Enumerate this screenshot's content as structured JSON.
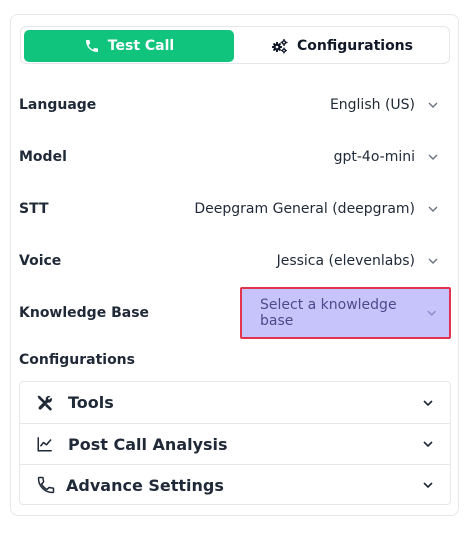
{
  "tabs": {
    "test_call": {
      "label": "Test Call",
      "icon": "phone-icon",
      "active": true
    },
    "configurations": {
      "label": "Configurations",
      "icon": "gears-icon",
      "active": false
    }
  },
  "fields": [
    {
      "label": "Language",
      "value": "English (US)"
    },
    {
      "label": "Model",
      "value": "gpt-4o-mini"
    },
    {
      "label": "STT",
      "value": "Deepgram General (deepgram)"
    },
    {
      "label": "Voice",
      "value": "Jessica (elevenlabs)"
    }
  ],
  "knowledge_base": {
    "label": "Knowledge Base",
    "placeholder": "Select a knowledge base"
  },
  "configurations_section": {
    "title": "Configurations",
    "items": [
      {
        "label": "Tools",
        "icon": "tools-icon"
      },
      {
        "label": "Post Call Analysis",
        "icon": "chart-line-icon"
      },
      {
        "label": "Advance Settings",
        "icon": "phone-icon"
      }
    ]
  },
  "colors": {
    "accent": "#10c47e",
    "highlight_fill": "#c7c4fb",
    "highlight_border": "#e0344f"
  }
}
